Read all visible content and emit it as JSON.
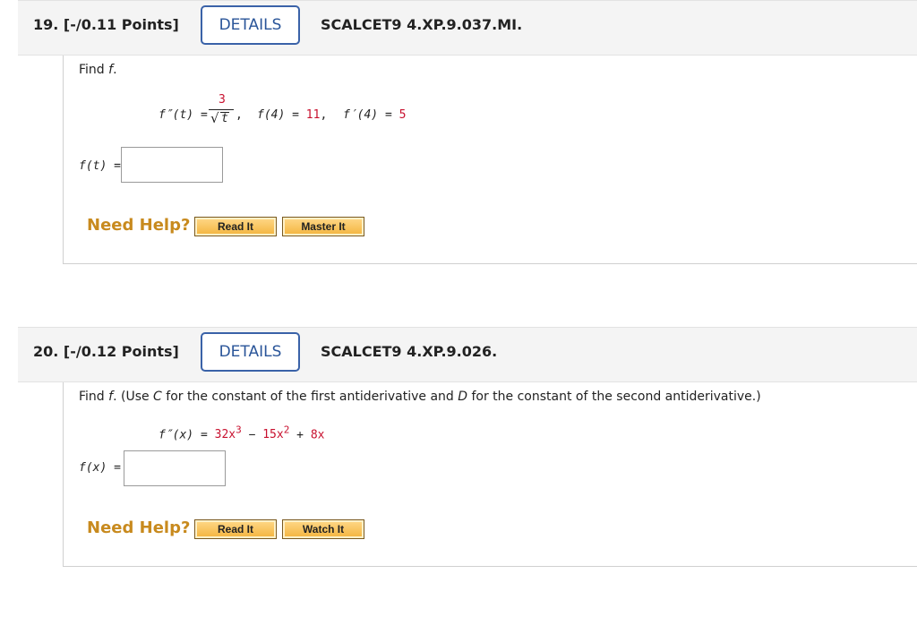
{
  "q19": {
    "number": "19.",
    "points": "[-/0.11 Points]",
    "details_label": "DETAILS",
    "code": "SCALCET9 4.XP.9.037.MI.",
    "prompt_find": "Find ",
    "prompt_var": "f",
    "prompt_end": ".",
    "given": {
      "lhs": "f″(t) =",
      "numerator": "3",
      "sqrt_symbol": "√",
      "radicand": "t",
      "comma1": ",",
      "f4_label": "f(4) =",
      "f4_value": "11",
      "comma2": ",",
      "fp4_label": "f′(4) =",
      "fp4_value": "5"
    },
    "answer_label": "f(t) =",
    "answer_value": "",
    "need_help": "Need Help?",
    "read_it": "Read It",
    "master_it": "Master It"
  },
  "q20": {
    "number": "20.",
    "points": "[-/0.12 Points]",
    "details_label": "DETAILS",
    "code": "SCALCET9 4.XP.9.026.",
    "prompt_a": "Find ",
    "prompt_f": "f",
    "prompt_b": ". (Use ",
    "prompt_c": "C",
    "prompt_d": " for the constant of the first antiderivative and ",
    "prompt_e": "D",
    "prompt_g": " for the constant of the second antiderivative.)",
    "given": {
      "lhs": "f″(x) =",
      "t1": "32x",
      "e1": "3",
      "op1": "−",
      "t2": "15x",
      "e2": "2",
      "op2": "+",
      "t3": "8x"
    },
    "answer_label": "f(x) =",
    "answer_value": "",
    "need_help": "Need Help?",
    "read_it": "Read It",
    "watch_it": "Watch It"
  }
}
